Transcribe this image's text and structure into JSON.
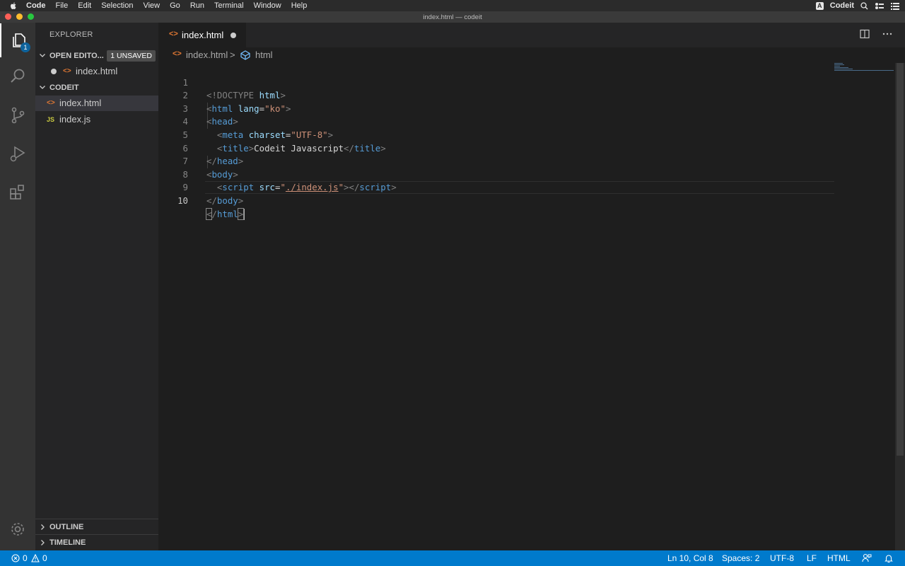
{
  "menubar": {
    "app": "Code",
    "items": [
      "File",
      "Edit",
      "Selection",
      "View",
      "Go",
      "Run",
      "Terminal",
      "Window",
      "Help"
    ],
    "right_input_indicator": "A",
    "right_user": "Codeit"
  },
  "window": {
    "title": "index.html — codeit"
  },
  "activity": {
    "explorer_badge": "1"
  },
  "sidebar": {
    "title": "EXPLORER",
    "open_editors": {
      "label": "OPEN EDITO...",
      "unsaved": "1 UNSAVED",
      "items": [
        {
          "icon": "<>",
          "name": "index.html"
        }
      ]
    },
    "folder": {
      "label": "CODEIT",
      "files": [
        {
          "icon": "<>",
          "name": "index.html"
        },
        {
          "icon": "JS",
          "name": "index.js"
        }
      ]
    },
    "outline": "OUTLINE",
    "timeline": "TIMELINE"
  },
  "tab": {
    "icon": "<>",
    "label": "index.html"
  },
  "breadcrumb": {
    "file": "index.html",
    "separator": ">",
    "symbol": "html"
  },
  "editor": {
    "line_numbers": [
      "1",
      "2",
      "3",
      "4",
      "5",
      "6",
      "7",
      "8",
      "9",
      "10"
    ],
    "current_line": "10"
  },
  "status": {
    "errors": "0",
    "warnings": "0",
    "position": "Ln 10, Col 8",
    "spaces": "Spaces: 2",
    "encoding": "UTF-8",
    "eol": "LF",
    "language": "HTML"
  },
  "colors": {
    "accent": "#007acc",
    "tag": "#569cd6",
    "attr": "#9cdcfe",
    "string": "#ce9178",
    "html_icon": "#e37933",
    "js_icon": "#cbcb41"
  }
}
